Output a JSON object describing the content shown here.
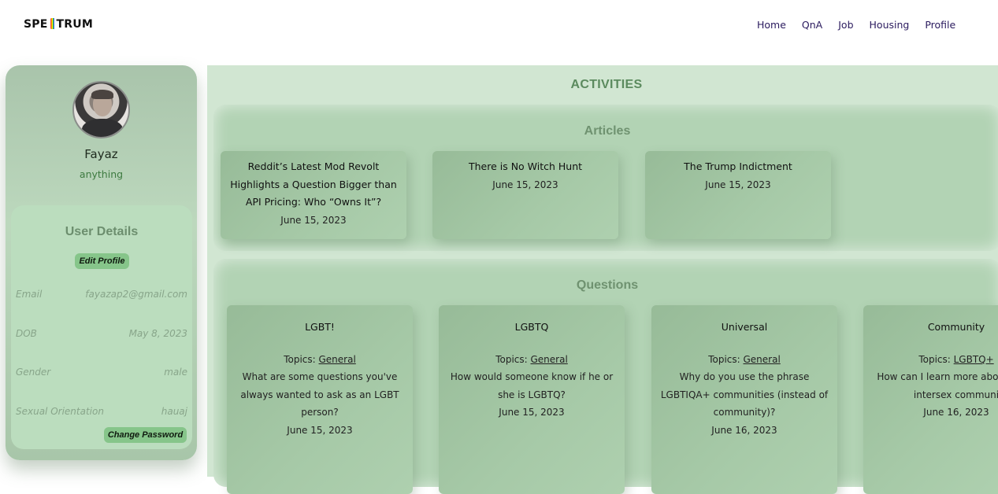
{
  "brand": {
    "logo_left": "SPE",
    "logo_right": "TRUM"
  },
  "nav": {
    "items": [
      {
        "label": "Home"
      },
      {
        "label": "QnA"
      },
      {
        "label": "Job"
      },
      {
        "label": "Housing"
      },
      {
        "label": "Profile"
      }
    ]
  },
  "profile": {
    "name": "Fayaz",
    "bio": "anything",
    "details": {
      "title": "User Details",
      "edit_label": "Edit Profile",
      "rows": [
        {
          "label": "Email",
          "value": "fayazap2@gmail.com"
        },
        {
          "label": "DOB",
          "value": "May 8, 2023"
        },
        {
          "label": "Gender",
          "value": "male"
        },
        {
          "label": "Sexual Orientation",
          "value": "hauaj"
        }
      ],
      "change_password_label": "Change Password"
    }
  },
  "activities": {
    "title": "ACTIVITIES",
    "articles": {
      "title": "Articles",
      "items": [
        {
          "title": "Reddit’s Latest Mod Revolt Highlights a Question Bigger than API Pricing: Who “Owns It”?",
          "date": "June 15, 2023"
        },
        {
          "title": "There is No Witch Hunt",
          "date": "June 15, 2023"
        },
        {
          "title": "The Trump Indictment",
          "date": "June 15, 2023"
        }
      ]
    },
    "questions": {
      "title": "Questions",
      "topics_label": "Topics:",
      "items": [
        {
          "title": "LGBT!",
          "topic": "General",
          "body": "What are some questions you've always wanted to ask as an LGBT person?",
          "date": "June 15, 2023"
        },
        {
          "title": "LGBTQ",
          "topic": "General",
          "body": "How would someone know if he or she is LGBTQ?",
          "date": "June 15, 2023"
        },
        {
          "title": "Universal",
          "topic": "General",
          "body": "Why do you use the phrase LGBTIQA+ communities (instead of community)?",
          "date": "June 16, 2023"
        },
        {
          "title": "Community",
          "topic": "LGBTQ+",
          "body": "How can I learn more about t and intersex communi",
          "date": "June 16, 2023"
        }
      ]
    }
  },
  "colors": {
    "accent_green": "#86c58a",
    "title_green": "#5b8a5e",
    "nav_text": "#2a1a5e"
  }
}
